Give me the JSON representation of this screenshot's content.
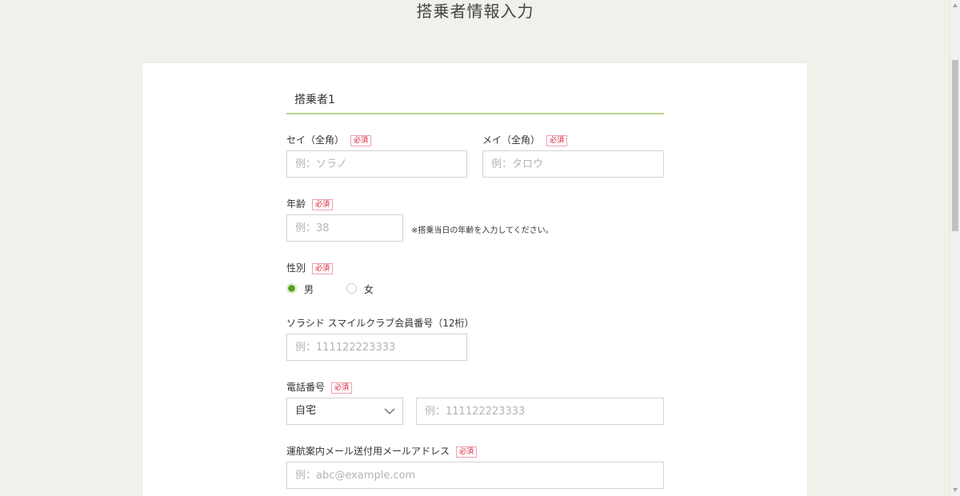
{
  "page": {
    "title": "搭乗者情報入力"
  },
  "passenger": {
    "section_title": "搭乗者1",
    "required_label": "必須",
    "sei": {
      "label": "セイ（全角）",
      "placeholder": "例：ソラノ"
    },
    "mei": {
      "label": "メイ（全角）",
      "placeholder": "例：タロウ"
    },
    "age": {
      "label": "年齢",
      "placeholder": "例：38",
      "note": "※搭乗当日の年齢を入力してください。"
    },
    "gender": {
      "label": "性別",
      "options": [
        {
          "label": "男",
          "checked": true
        },
        {
          "label": "女",
          "checked": false
        }
      ]
    },
    "member": {
      "label": "ソラシド スマイルクラブ会員番号（12桁）",
      "placeholder": "例：111122223333"
    },
    "phone": {
      "label": "電話番号",
      "type_selected": "自宅",
      "placeholder": "例：111122223333"
    },
    "email": {
      "label": "運航案内メール送付用メールアドレス",
      "placeholder": "例：abc@example.com"
    }
  },
  "colors": {
    "accent_green": "#5aa11f",
    "section_underline": "#b8d48c",
    "required_red": "#d8203a",
    "background": "#f1f0eb"
  },
  "icons": {
    "select_arrow": "chevron-down-icon",
    "scroll_up": "scroll-up-arrow-icon",
    "scroll_down": "scroll-down-arrow-icon"
  }
}
